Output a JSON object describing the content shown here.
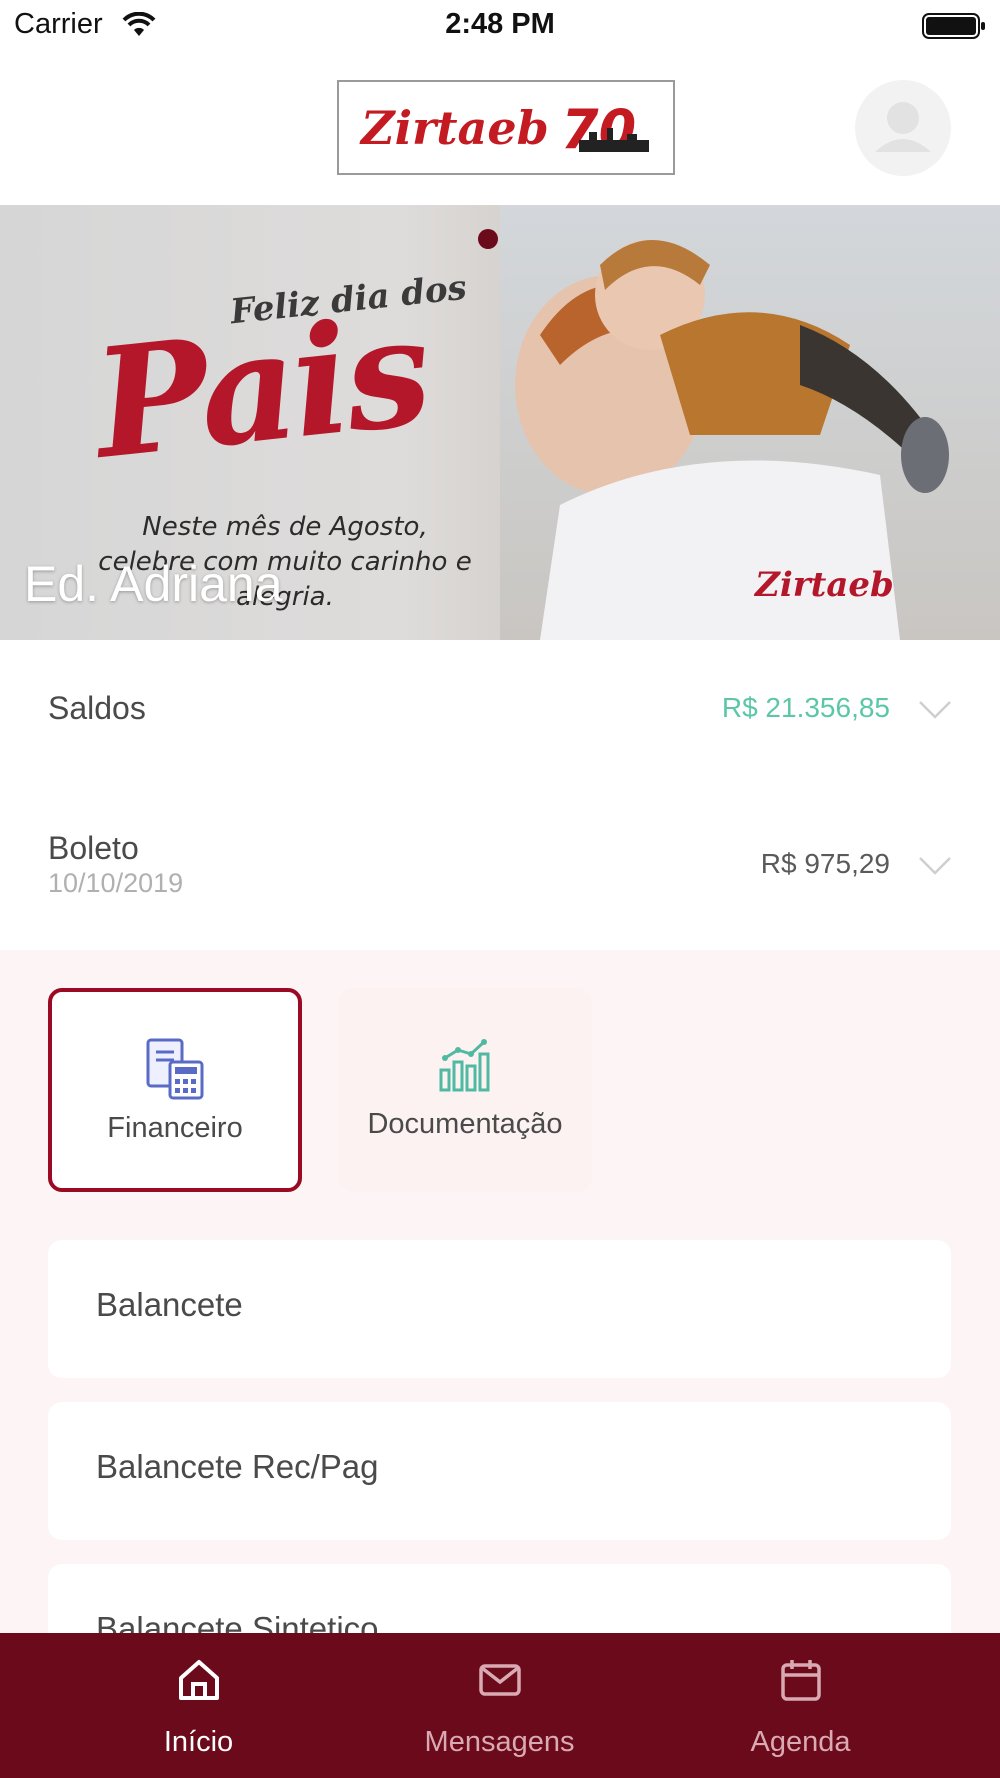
{
  "status_bar": {
    "carrier": "Carrier",
    "time": "2:48 PM"
  },
  "header": {
    "logo_text": "Zirtaeb",
    "logo_number": "70",
    "avatar_icon": "user-avatar-icon"
  },
  "banner": {
    "headline_small": "Feliz dia dos",
    "headline_large": "Pais",
    "caption": "Neste mês de Agosto, celebre com muito carinho e alegria.",
    "brand": "Zirtaeb",
    "title": "Ed. Adriana",
    "page_count": 1,
    "active_page": 1
  },
  "summary": {
    "saldos": {
      "label": "Saldos",
      "value": "R$ 21.356,85",
      "value_color": "#5cc7a8"
    },
    "boleto": {
      "label": "Boleto",
      "date": "10/10/2019",
      "value": "R$ 975,29",
      "value_color": "#5a5a5a"
    }
  },
  "categories": [
    {
      "label": "Financeiro",
      "icon": "calculator-document-icon",
      "selected": true
    },
    {
      "label": "Documentação",
      "icon": "bar-chart-icon",
      "selected": false
    }
  ],
  "list_items": [
    {
      "label": "Balancete"
    },
    {
      "label": "Balancete Rec/Pag"
    },
    {
      "label": "Balancete Sintetico"
    }
  ],
  "tabbar": {
    "tabs": [
      {
        "label": "Início",
        "icon": "home-icon",
        "active": true
      },
      {
        "label": "Mensagens",
        "icon": "mail-icon",
        "active": false
      },
      {
        "label": "Agenda",
        "icon": "calendar-icon",
        "active": false
      }
    ],
    "active_color": "#ffffff",
    "inactive_color": "#d9aab3",
    "background": "#6b0a1a"
  },
  "colors": {
    "brand": "#9b0a24",
    "tabbar": "#6b0a1a",
    "positive": "#5cc7a8"
  }
}
